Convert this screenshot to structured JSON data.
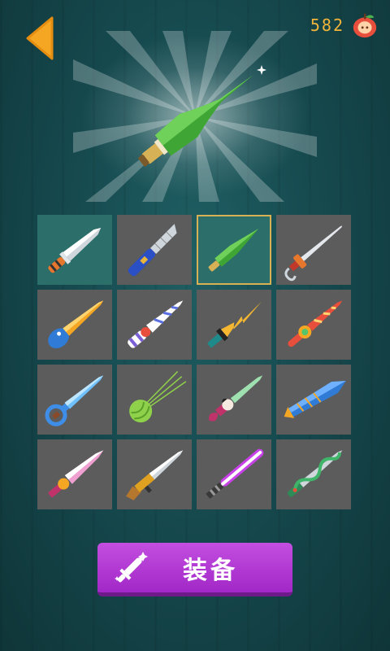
{
  "header": {
    "back_icon": "triangle-left-arrow",
    "coin_count": "582",
    "coin_icon": "apple-icon"
  },
  "preview": {
    "knife": "green-spike-knife"
  },
  "grid": {
    "rows": 4,
    "cols": 4,
    "items": [
      {
        "id": "classic-knife",
        "owned": true,
        "selected": false
      },
      {
        "id": "box-cutter",
        "owned": false,
        "selected": false
      },
      {
        "id": "green-spike-knife",
        "owned": true,
        "selected": true
      },
      {
        "id": "hook-saber",
        "owned": false,
        "selected": false
      },
      {
        "id": "bird-knife",
        "owned": false,
        "selected": false
      },
      {
        "id": "candy-cane-knife",
        "owned": false,
        "selected": false
      },
      {
        "id": "lightning-knife",
        "owned": false,
        "selected": false
      },
      {
        "id": "lollipop-knife",
        "owned": false,
        "selected": false
      },
      {
        "id": "key-knife",
        "owned": false,
        "selected": false
      },
      {
        "id": "yarn-ball-knife",
        "owned": false,
        "selected": false
      },
      {
        "id": "geisha-knife",
        "owned": false,
        "selected": false
      },
      {
        "id": "fish-knife",
        "owned": false,
        "selected": false
      },
      {
        "id": "pink-dagger",
        "owned": false,
        "selected": false
      },
      {
        "id": "rifle-knife",
        "owned": false,
        "selected": false
      },
      {
        "id": "lightsaber",
        "owned": false,
        "selected": false
      },
      {
        "id": "snake-knife",
        "owned": false,
        "selected": false
      }
    ]
  },
  "equip_button": {
    "label": "装备",
    "icon": "sparkling-sword-icon"
  },
  "colors": {
    "coin": "#f2b43a",
    "button": "#b33ad6",
    "selected_border": "#d7b153",
    "owned_cell": "#2c6e6a",
    "locked_cell": "#5c5c5c"
  }
}
